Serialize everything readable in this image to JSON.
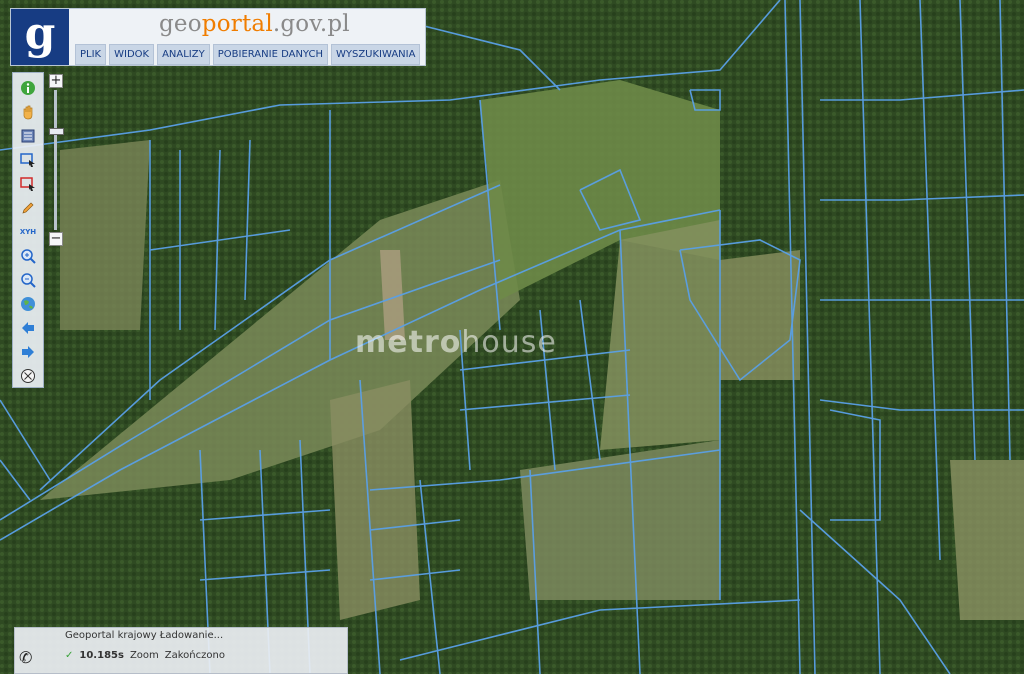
{
  "header": {
    "logo_letter": "g",
    "title_prefix": "geo",
    "title_brand": "portal",
    "title_suffix": ".gov.pl"
  },
  "menu": [
    {
      "label": "PLIK"
    },
    {
      "label": "WIDOK"
    },
    {
      "label": "ANALIZY"
    },
    {
      "label": "POBIERANIE DANYCH"
    },
    {
      "label": "WYSZUKIWANIA"
    }
  ],
  "toolbar": {
    "tools": [
      {
        "name": "info-icon"
      },
      {
        "name": "pan-hand-icon"
      },
      {
        "name": "legend-icon"
      },
      {
        "name": "select-blue-icon"
      },
      {
        "name": "select-red-icon"
      },
      {
        "name": "pencil-icon"
      },
      {
        "name": "xyh-icon",
        "label": "XYH"
      },
      {
        "name": "zoom-in-icon"
      },
      {
        "name": "zoom-out-icon"
      },
      {
        "name": "globe-icon"
      },
      {
        "name": "back-arrow-icon"
      },
      {
        "name": "forward-arrow-icon"
      },
      {
        "name": "clear-icon"
      }
    ]
  },
  "zoom": {
    "plus": "+",
    "minus": "−"
  },
  "watermark": {
    "bold": "metro",
    "light": "house"
  },
  "status": {
    "row1": "Geoportal krajowy  Ładowanie...",
    "time": "10.185s",
    "action": "Zoom",
    "result": "Zakończono"
  },
  "colors": {
    "parcel_lines": "#5aa0e6",
    "header_blue": "#173c83",
    "brand_orange": "#f07d00"
  }
}
